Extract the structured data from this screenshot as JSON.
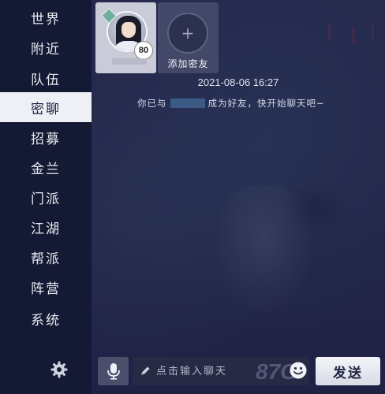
{
  "sidebar": {
    "items": [
      {
        "label": "世界",
        "active": false
      },
      {
        "label": "附近",
        "active": false
      },
      {
        "label": "队伍",
        "active": false
      },
      {
        "label": "密聊",
        "active": true
      },
      {
        "label": "招募",
        "active": false
      },
      {
        "label": "金兰",
        "active": false
      },
      {
        "label": "门派",
        "active": false
      },
      {
        "label": "江湖",
        "active": false
      },
      {
        "label": "帮派",
        "active": false
      },
      {
        "label": "阵营",
        "active": false
      },
      {
        "label": "系统",
        "active": false
      }
    ],
    "settings_icon": "gear-icon"
  },
  "friends": {
    "card": {
      "level": "80"
    },
    "add_label": "添加密友"
  },
  "chat": {
    "timestamp": "2021-08-06 16:27",
    "system_message_prefix": "你已与",
    "system_message_suffix": "成为好友，快开始聊天吧~"
  },
  "input_bar": {
    "placeholder": "点击输入聊天",
    "value": "",
    "send_label": "发送",
    "mic_icon": "microphone-icon",
    "pen_icon": "pen-icon",
    "emoji_icon": "smiley-icon"
  },
  "watermark": {
    "text": "87G"
  },
  "colors": {
    "sidebar_bg": "#141a33",
    "active_tab_bg": "#eef0f6",
    "send_button_bg": "#e6e8f0"
  }
}
